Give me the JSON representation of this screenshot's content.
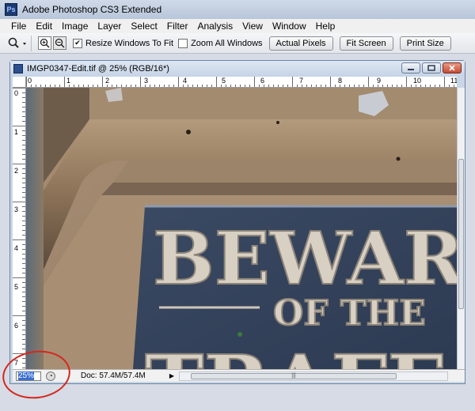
{
  "app": {
    "title": "Adobe Photoshop CS3 Extended",
    "logo_text": "Ps"
  },
  "menu": [
    "File",
    "Edit",
    "Image",
    "Layer",
    "Select",
    "Filter",
    "Analysis",
    "View",
    "Window",
    "Help"
  ],
  "options": {
    "zoom_tool_icon": "magnifier-icon",
    "resize_windows_label": "Resize Windows To Fit",
    "resize_windows_checked": true,
    "zoom_all_label": "Zoom All Windows",
    "zoom_all_checked": false,
    "actual_pixels": "Actual Pixels",
    "fit_screen": "Fit Screen",
    "print_size": "Print Size"
  },
  "document": {
    "title": "IMGP0347-Edit.tif @ 25% (RGB/16*)",
    "zoom": "25%",
    "doc_info": "Doc: 57.4M/57.4M",
    "hruler_numbers": [
      "0",
      "1",
      "2",
      "3",
      "4",
      "5",
      "6",
      "7",
      "8",
      "9",
      "10",
      "11"
    ],
    "vruler_numbers": [
      "0",
      "1",
      "2",
      "3",
      "4",
      "5",
      "6",
      "7"
    ],
    "photo_text": {
      "line1": "BEWAR",
      "line2": "OF THE",
      "line3": "TRAFF"
    }
  },
  "colors": {
    "annotation_circle": "#d4281f",
    "zoom_highlight": "#3a6fce"
  }
}
